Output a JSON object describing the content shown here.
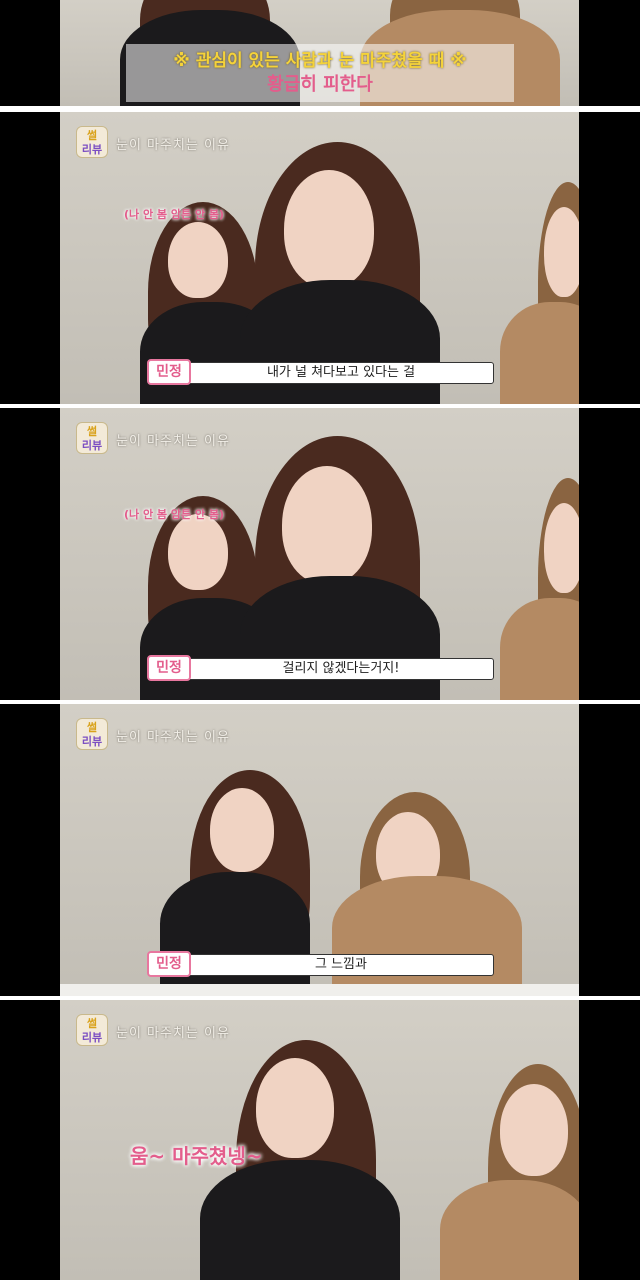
{
  "top_panel": {
    "line1": "※ 관심이 있는 사람과 눈 마주쳤을 때 ※",
    "line2": "황급히 피한다"
  },
  "show": {
    "logo_top": "썰",
    "logo_bottom": "리뷰",
    "topic": "눈이 마주치는 이유"
  },
  "panels": [
    {
      "name": "민정",
      "caption": "내가 널 쳐다보고 있다는 걸",
      "thought": "(나 안 봄 암튼 안 봄)"
    },
    {
      "name": "민정",
      "caption": "걸리지 않겠다는거지!",
      "thought": "(나 안 봄 암튼 안 봄)"
    },
    {
      "name": "민정",
      "caption": "그 느낌과"
    },
    {
      "speech": "움~ 마주쳤넹~"
    }
  ],
  "colors": {
    "accent_pink": "#e35d8c",
    "highlight_yellow": "#f5d33a",
    "background": "#cbc7be"
  }
}
